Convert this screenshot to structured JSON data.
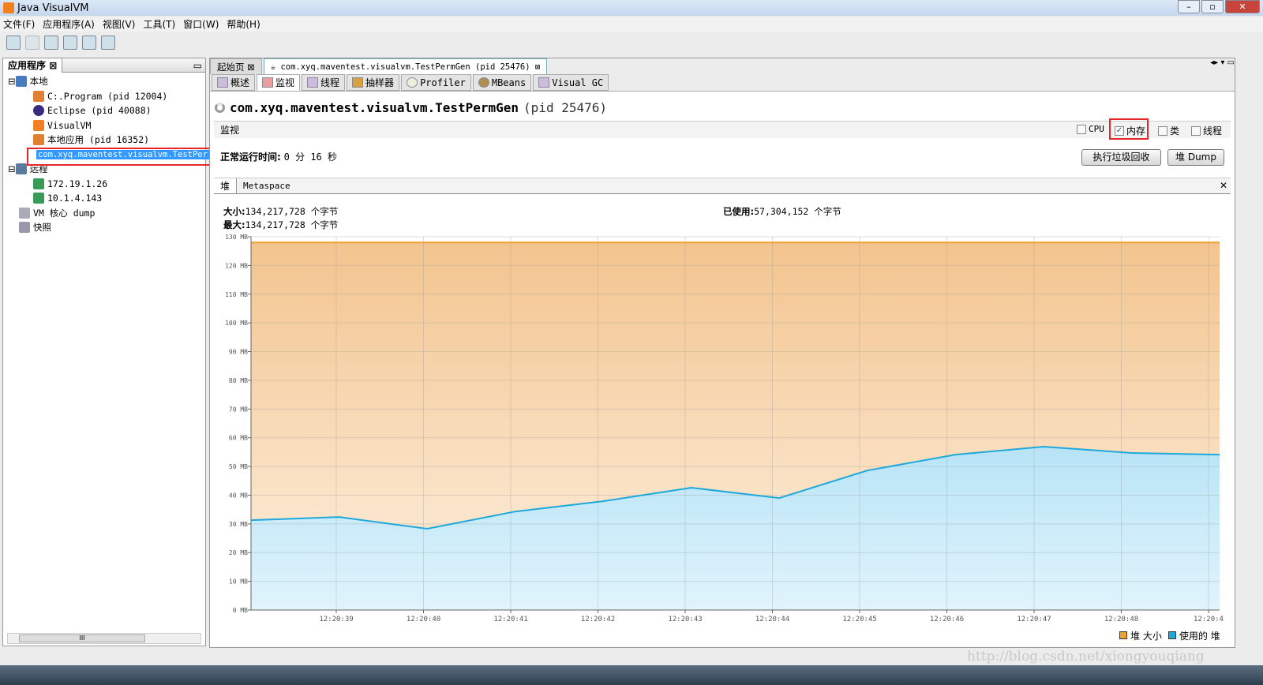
{
  "window": {
    "title": "Java VisualVM"
  },
  "menu": [
    "文件(F)",
    "应用程序(A)",
    "视图(V)",
    "工具(T)",
    "窗口(W)",
    "帮助(H)"
  ],
  "toolbar_icons": [
    "open-icon",
    "save-icon",
    "add-jmx-icon",
    "add-jmx-connection-icon",
    "add-core-dump-icon",
    "add-snapshot-icon"
  ],
  "sidebar": {
    "tab": "应用程序",
    "local": "本地",
    "local_items": [
      "C:.Program (pid 12004)",
      "Eclipse (pid 40088)",
      "VisualVM",
      "本地应用 (pid 16352)",
      "com.xyq.maventest.visualvm.TestPer"
    ],
    "remote": "远程",
    "remote_items": [
      "172.19.1.26",
      "10.1.4.143"
    ],
    "core_dump": "VM 核心 dump",
    "snapshots": "快照",
    "scroll_mark": "III"
  },
  "doc_tabs": [
    "起始页",
    "com.xyq.maventest.visualvm.TestPermGen (pid 25476)"
  ],
  "sub_tabs": [
    "概述",
    "监视",
    "线程",
    "抽样器",
    "Profiler",
    "MBeans",
    "Visual GC"
  ],
  "main": {
    "process_name": "com.xyq.maventest.visualvm.TestPermGen",
    "process_pid": "(pid 25476)",
    "section": "监视",
    "checkboxes": [
      {
        "label": "CPU",
        "checked": false
      },
      {
        "label": "内存",
        "checked": true
      },
      {
        "label": "类",
        "checked": false
      },
      {
        "label": "线程",
        "checked": false
      }
    ],
    "uptime_label": "正常运行时间:",
    "uptime_value": "0 分 16 秒",
    "gc_button": "执行垃圾回收",
    "heap_dump_button": "堆 Dump",
    "heap_tabs": [
      "堆",
      "Metaspace"
    ],
    "size_label": "大小:",
    "size_value": "134,217,728 个字节",
    "max_label": "最大:",
    "max_value": "134,217,728 个字节",
    "used_label": "已使用:",
    "used_value": "57,304,152 个字节"
  },
  "colors": {
    "heap_size": "#f0a030",
    "used_heap": "#1ea8dc",
    "selection": "#3399ff",
    "highlight_box": "#e8262a"
  },
  "chart_data": {
    "type": "area",
    "ylim": [
      0,
      130
    ],
    "yticks": [
      "0 MB",
      "10 MB",
      "20 MB",
      "30 MB",
      "40 MB",
      "50 MB",
      "60 MB",
      "70 MB",
      "80 MB",
      "90 MB",
      "100 MB",
      "110 MB",
      "120 MB",
      "130 MB"
    ],
    "xticks": [
      "12:20:39",
      "12:20:40",
      "12:20:41",
      "12:20:42",
      "12:20:43",
      "12:20:44",
      "12:20:45",
      "12:20:46",
      "12:20:47",
      "12:20:48",
      "12:20:4"
    ],
    "grid": true,
    "legend_position": "bottom-right",
    "x": [
      "12:20:38",
      "12:20:39",
      "12:20:40",
      "12:20:41",
      "12:20:42",
      "12:20:43",
      "12:20:44",
      "12:20:45",
      "12:20:46",
      "12:20:47",
      "12:20:48",
      "12:20:49"
    ],
    "series": [
      {
        "name": "堆 大小",
        "values": [
          128,
          128,
          128,
          128,
          128,
          128,
          128,
          128,
          128,
          128,
          128,
          128
        ]
      },
      {
        "name": "使用的 堆",
        "values": [
          31.3,
          32.4,
          28.3,
          34.3,
          37.9,
          42.6,
          39.0,
          48.6,
          54.1,
          56.9,
          54.7,
          54.1
        ]
      }
    ]
  },
  "watermark": "http://blog.csdn.net/xiongyouqiang"
}
